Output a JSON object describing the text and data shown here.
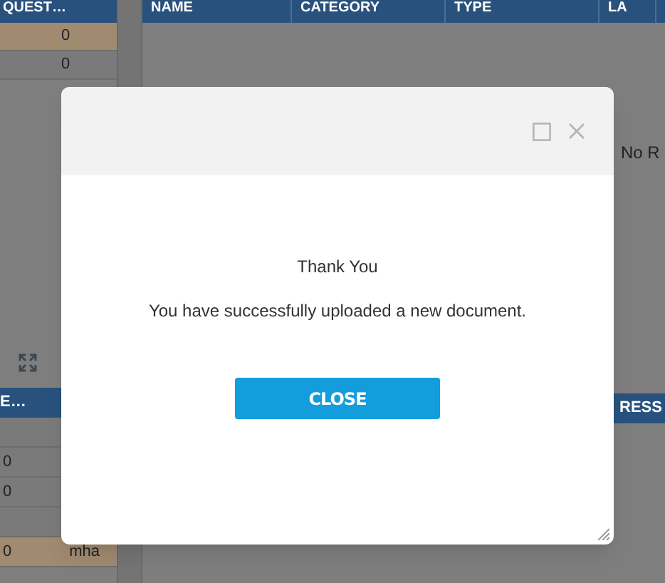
{
  "background": {
    "left_table": {
      "header": "QUEST…",
      "rows": [
        {
          "cells": [
            "0"
          ],
          "selected": true
        },
        {
          "cells": [
            "0"
          ],
          "selected": false
        }
      ]
    },
    "main_table": {
      "columns": [
        "NAME",
        "CATEGORY",
        "TYPE",
        "LA"
      ],
      "empty_text": "No R"
    },
    "lower_left_table": {
      "header": "E…",
      "rows": [
        {
          "cells": [
            "",
            ""
          ],
          "selected": false
        },
        {
          "cells": [
            "0",
            ""
          ],
          "selected": false
        },
        {
          "cells": [
            "0",
            ""
          ],
          "selected": false
        },
        {
          "cells": [
            "",
            ""
          ],
          "selected": false
        },
        {
          "cells": [
            "0",
            "mha"
          ],
          "selected": true
        }
      ]
    },
    "lower_right_table": {
      "header": "RESS"
    }
  },
  "dialog": {
    "maximizable": true,
    "closable": true,
    "heading": "Thank You",
    "message": "You have successfully uploaded a new document.",
    "button": "CLOSE"
  }
}
